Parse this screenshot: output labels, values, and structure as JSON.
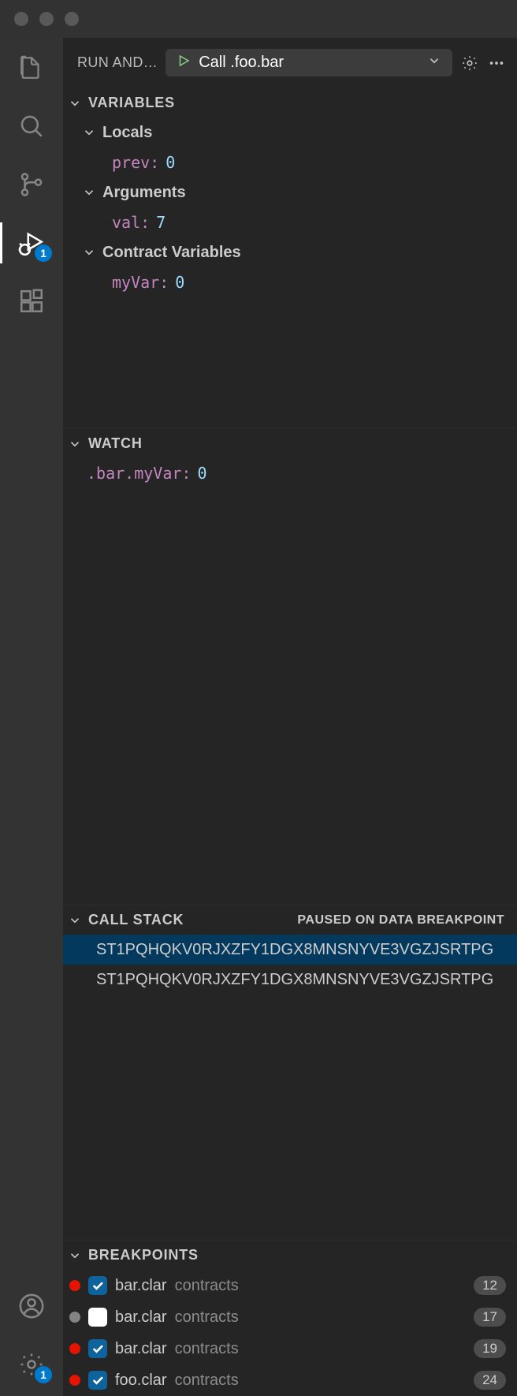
{
  "header": {
    "panel_title": "RUN AND…",
    "config_name": "Call .foo.bar"
  },
  "activity": {
    "debug_badge": "1",
    "settings_badge": "1"
  },
  "variables": {
    "title": "VARIABLES",
    "scopes": [
      {
        "name": "Locals",
        "vars": [
          {
            "name": "prev:",
            "value": "0"
          }
        ]
      },
      {
        "name": "Arguments",
        "vars": [
          {
            "name": "val:",
            "value": "7"
          }
        ]
      },
      {
        "name": "Contract Variables",
        "vars": [
          {
            "name": "myVar:",
            "value": "0"
          }
        ]
      }
    ]
  },
  "watch": {
    "title": "WATCH",
    "items": [
      {
        "expr": ".bar.myVar:",
        "value": "0"
      }
    ]
  },
  "callstack": {
    "title": "CALL STACK",
    "status": "PAUSED ON DATA BREAKPOINT",
    "frames": [
      "ST1PQHQKV0RJXZFY1DGX8MNSNYVE3VGZJSRTPG",
      "ST1PQHQKV0RJXZFY1DGX8MNSNYVE3VGZJSRTPG"
    ]
  },
  "breakpoints": {
    "title": "BREAKPOINTS",
    "items": [
      {
        "enabled": true,
        "checked": true,
        "file": "bar.clar",
        "dir": "contracts",
        "line": "12"
      },
      {
        "enabled": false,
        "checked": false,
        "file": "bar.clar",
        "dir": "contracts",
        "line": "17"
      },
      {
        "enabled": true,
        "checked": true,
        "file": "bar.clar",
        "dir": "contracts",
        "line": "19"
      },
      {
        "enabled": true,
        "checked": true,
        "file": "foo.clar",
        "dir": "contracts",
        "line": "24"
      }
    ]
  }
}
